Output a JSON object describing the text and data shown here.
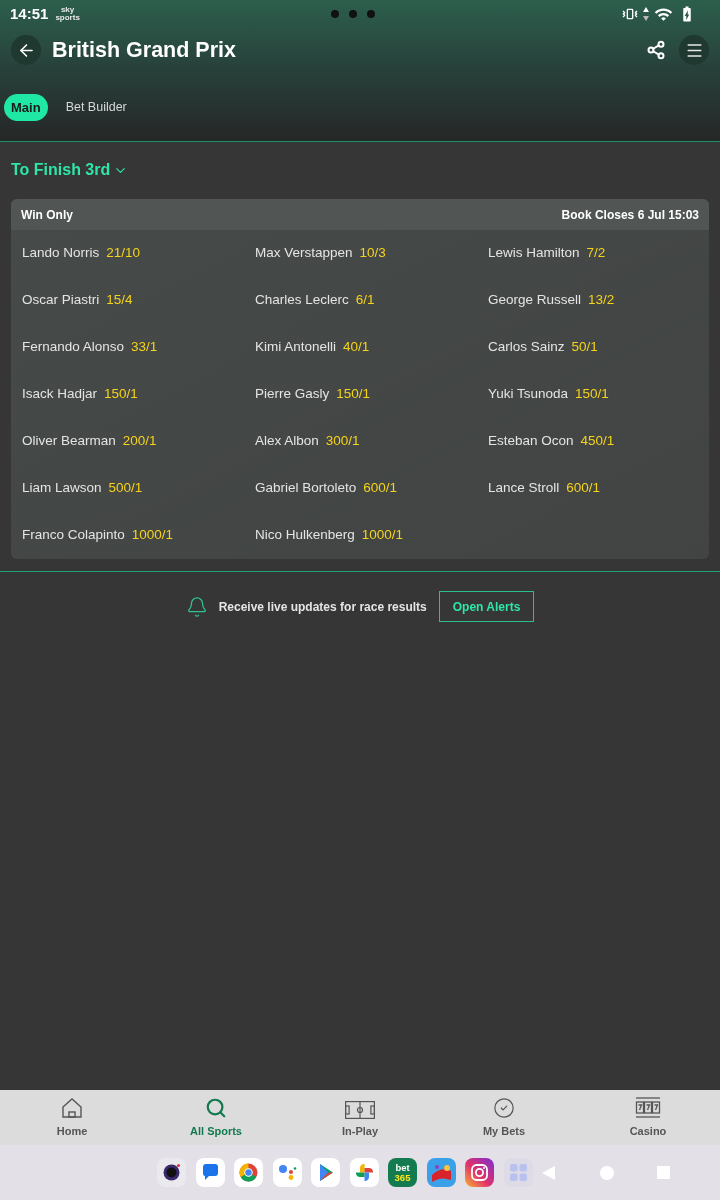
{
  "status_bar": {
    "time": "14:51",
    "notification_logo": [
      "sky",
      "sports"
    ]
  },
  "header": {
    "title": "British Grand Prix"
  },
  "tabs": [
    {
      "label": "Main",
      "selected": true
    },
    {
      "label": "Bet Builder",
      "selected": false
    }
  ],
  "market": {
    "title": "To Finish 3rd"
  },
  "card": {
    "header_left": "Win Only",
    "header_right": "Book Closes 6 Jul 15:03",
    "selections": [
      {
        "name": "Lando Norris",
        "odds": "21/10"
      },
      {
        "name": "Max Verstappen",
        "odds": "10/3"
      },
      {
        "name": "Lewis Hamilton",
        "odds": "7/2"
      },
      {
        "name": "Oscar Piastri",
        "odds": "15/4"
      },
      {
        "name": "Charles Leclerc",
        "odds": "6/1"
      },
      {
        "name": "George Russell",
        "odds": "13/2"
      },
      {
        "name": "Fernando Alonso",
        "odds": "33/1"
      },
      {
        "name": "Kimi Antonelli",
        "odds": "40/1"
      },
      {
        "name": "Carlos Sainz",
        "odds": "50/1"
      },
      {
        "name": "Isack Hadjar",
        "odds": "150/1"
      },
      {
        "name": "Pierre Gasly",
        "odds": "150/1"
      },
      {
        "name": "Yuki Tsunoda",
        "odds": "150/1"
      },
      {
        "name": "Oliver Bearman",
        "odds": "200/1"
      },
      {
        "name": "Alex Albon",
        "odds": "300/1"
      },
      {
        "name": "Esteban Ocon",
        "odds": "450/1"
      },
      {
        "name": "Liam Lawson",
        "odds": "500/1"
      },
      {
        "name": "Gabriel Bortoleto",
        "odds": "600/1"
      },
      {
        "name": "Lance Stroll",
        "odds": "600/1"
      },
      {
        "name": "Franco Colapinto",
        "odds": "1000/1"
      },
      {
        "name": "Nico Hulkenberg",
        "odds": "1000/1"
      }
    ]
  },
  "alert": {
    "text": "Receive live updates for race results",
    "button": "Open Alerts"
  },
  "bottom_nav": [
    {
      "label": "Home",
      "selected": false
    },
    {
      "label": "All Sports",
      "selected": true
    },
    {
      "label": "In-Play",
      "selected": false
    },
    {
      "label": "My Bets",
      "selected": false
    },
    {
      "label": "Casino",
      "selected": false
    }
  ],
  "dock": {
    "tile_text": [
      "bet",
      "365"
    ]
  }
}
